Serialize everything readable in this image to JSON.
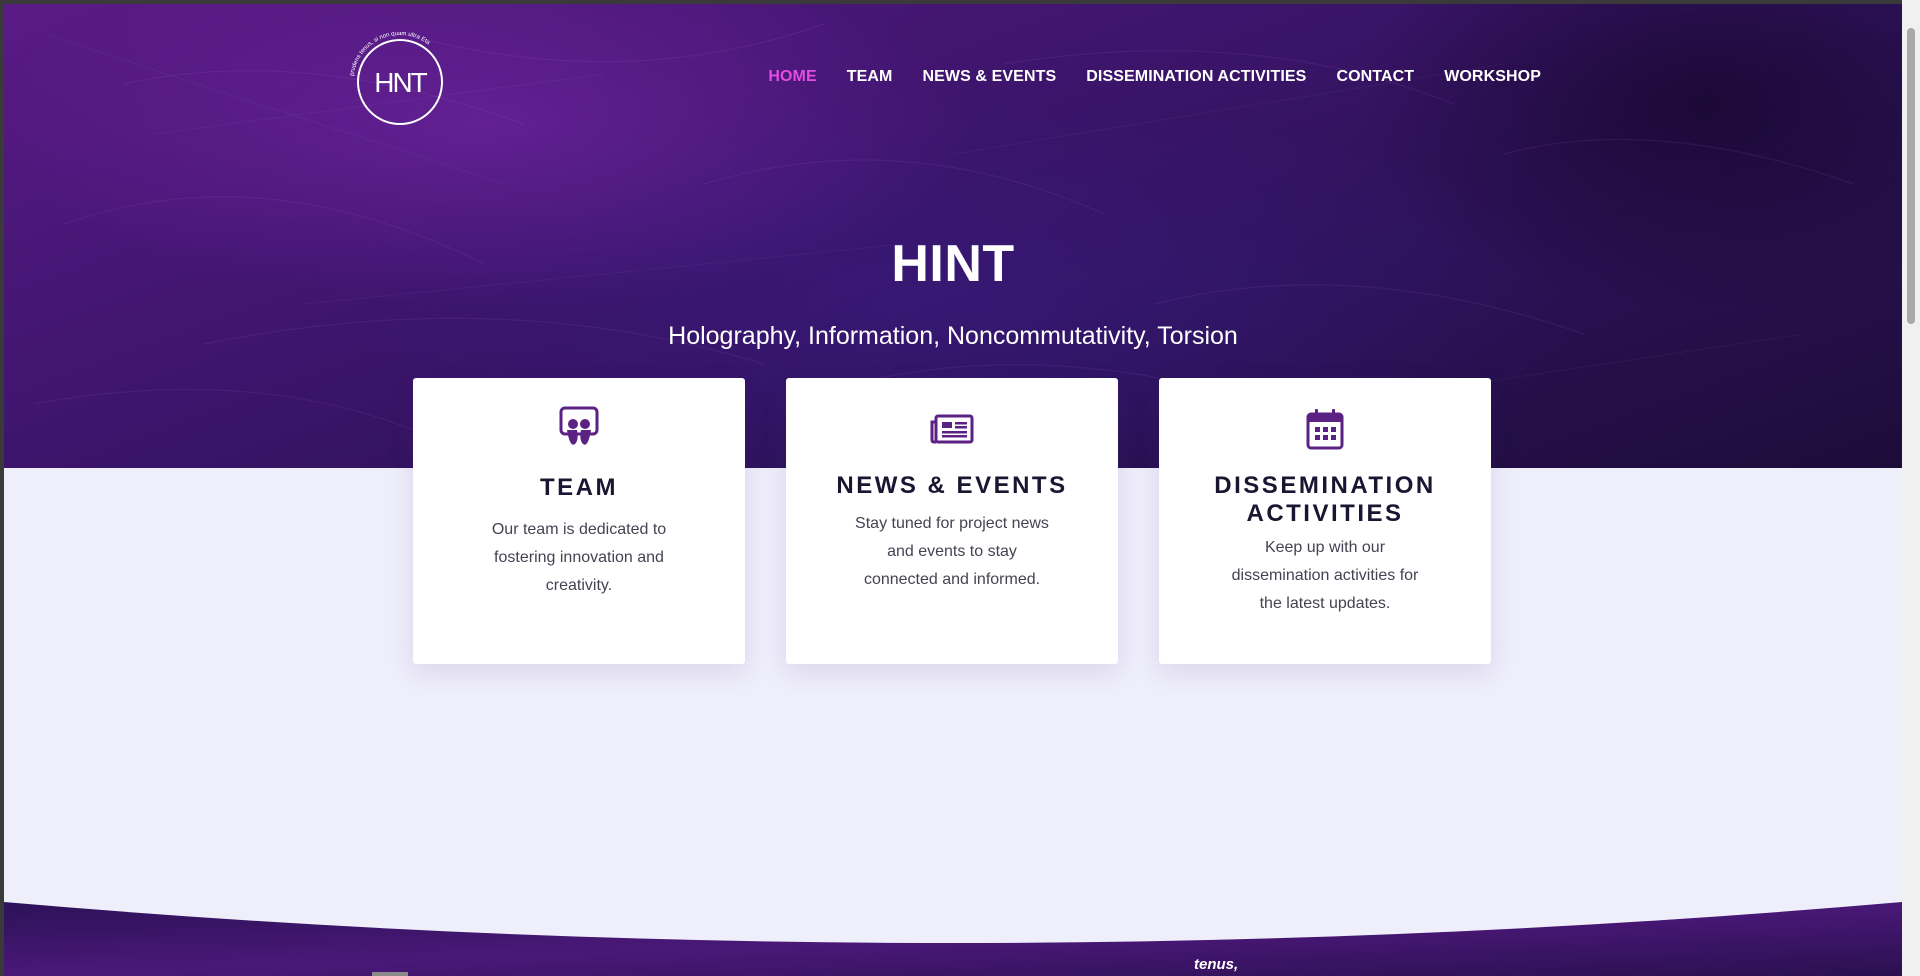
{
  "brand": {
    "logo_text": "HNT",
    "logo_ring_text": "prudens tenus, si non quam ultra Eta",
    "accent_color": "#e14ee1",
    "hero_colors": [
      "#5a1a86",
      "#2c1258",
      "#1d0c3a"
    ],
    "surface_color": "#efeefb"
  },
  "nav": {
    "items": [
      {
        "label": "HOME",
        "active": true
      },
      {
        "label": "TEAM",
        "active": false
      },
      {
        "label": "NEWS & EVENTS",
        "active": false
      },
      {
        "label": "DISSEMINATION ACTIVITIES",
        "active": false
      },
      {
        "label": "CONTACT",
        "active": false
      },
      {
        "label": "WORKSHOP",
        "active": false
      }
    ]
  },
  "hero": {
    "title": "HINT",
    "subtitle": "Holography, Information, Noncommutativity, Torsion"
  },
  "cards": [
    {
      "icon": "slideshare-icon",
      "title": "TEAM",
      "text": "Our team is dedicated to fostering innovation and creativity."
    },
    {
      "icon": "newspaper-icon",
      "title": "NEWS & EVENTS",
      "text": "Stay tuned for project news and events to stay connected and informed."
    },
    {
      "icon": "calendar-icon",
      "title": "DISSEMINATION ACTIVITIES",
      "text": "Keep up with our dissemination activities for the latest updates."
    }
  ],
  "footer": {
    "logo_partial_text": "tenus,"
  }
}
